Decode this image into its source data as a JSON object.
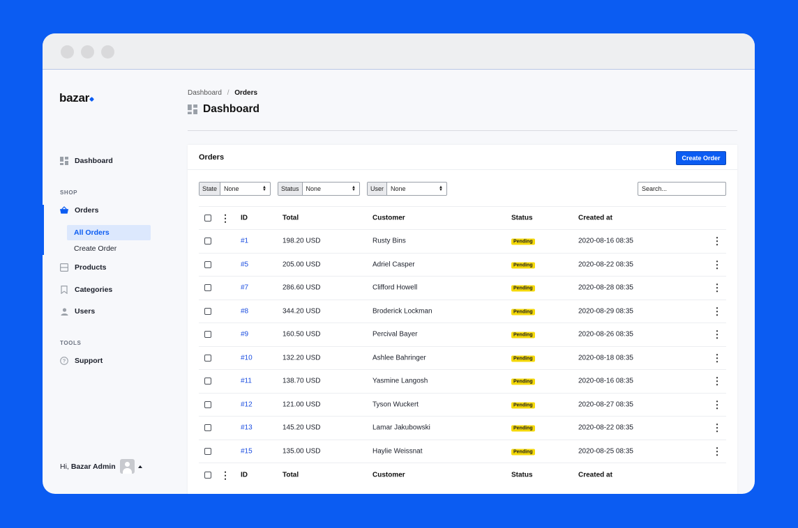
{
  "app": {
    "logo": "bazar"
  },
  "sidebar": {
    "dashboard": "Dashboard",
    "shop_heading": "SHOP",
    "orders": "Orders",
    "all_orders": "All Orders",
    "create_order": "Create Order",
    "products": "Products",
    "categories": "Categories",
    "users": "Users",
    "tools_heading": "TOOLS",
    "support": "Support",
    "greeting": "Hi,",
    "user_name": "Bazar Admin"
  },
  "breadcrumb": {
    "parent": "Dashboard",
    "separator": "/",
    "current": "Orders"
  },
  "page_title": "Dashboard",
  "card": {
    "title": "Orders",
    "create_button": "Create Order"
  },
  "filters": {
    "state": {
      "label": "State",
      "value": "None"
    },
    "status": {
      "label": "Status",
      "value": "None"
    },
    "user": {
      "label": "User",
      "value": "None"
    },
    "search_placeholder": "Search..."
  },
  "table": {
    "columns": {
      "id": "ID",
      "total": "Total",
      "customer": "Customer",
      "status": "Status",
      "created": "Created at"
    },
    "rows": [
      {
        "id": "#1",
        "total": "198.20 USD",
        "customer": "Rusty Bins",
        "status": "Pending",
        "created": "2020-08-16 08:35"
      },
      {
        "id": "#5",
        "total": "205.00 USD",
        "customer": "Adriel Casper",
        "status": "Pending",
        "created": "2020-08-22 08:35"
      },
      {
        "id": "#7",
        "total": "286.60 USD",
        "customer": "Clifford Howell",
        "status": "Pending",
        "created": "2020-08-28 08:35"
      },
      {
        "id": "#8",
        "total": "344.20 USD",
        "customer": "Broderick Lockman",
        "status": "Pending",
        "created": "2020-08-29 08:35"
      },
      {
        "id": "#9",
        "total": "160.50 USD",
        "customer": "Percival Bayer",
        "status": "Pending",
        "created": "2020-08-26 08:35"
      },
      {
        "id": "#10",
        "total": "132.20 USD",
        "customer": "Ashlee Bahringer",
        "status": "Pending",
        "created": "2020-08-18 08:35"
      },
      {
        "id": "#11",
        "total": "138.70 USD",
        "customer": "Yasmine Langosh",
        "status": "Pending",
        "created": "2020-08-16 08:35"
      },
      {
        "id": "#12",
        "total": "121.00 USD",
        "customer": "Tyson Wuckert",
        "status": "Pending",
        "created": "2020-08-27 08:35"
      },
      {
        "id": "#13",
        "total": "145.20 USD",
        "customer": "Lamar Jakubowski",
        "status": "Pending",
        "created": "2020-08-22 08:35"
      },
      {
        "id": "#15",
        "total": "135.00 USD",
        "customer": "Haylie Weissnat",
        "status": "Pending",
        "created": "2020-08-25 08:35"
      }
    ]
  },
  "colors": {
    "background": "#0b5cf2",
    "accent": "#0b5cf2",
    "badge_pending": "#f5d90a",
    "link": "#1a4de0"
  }
}
